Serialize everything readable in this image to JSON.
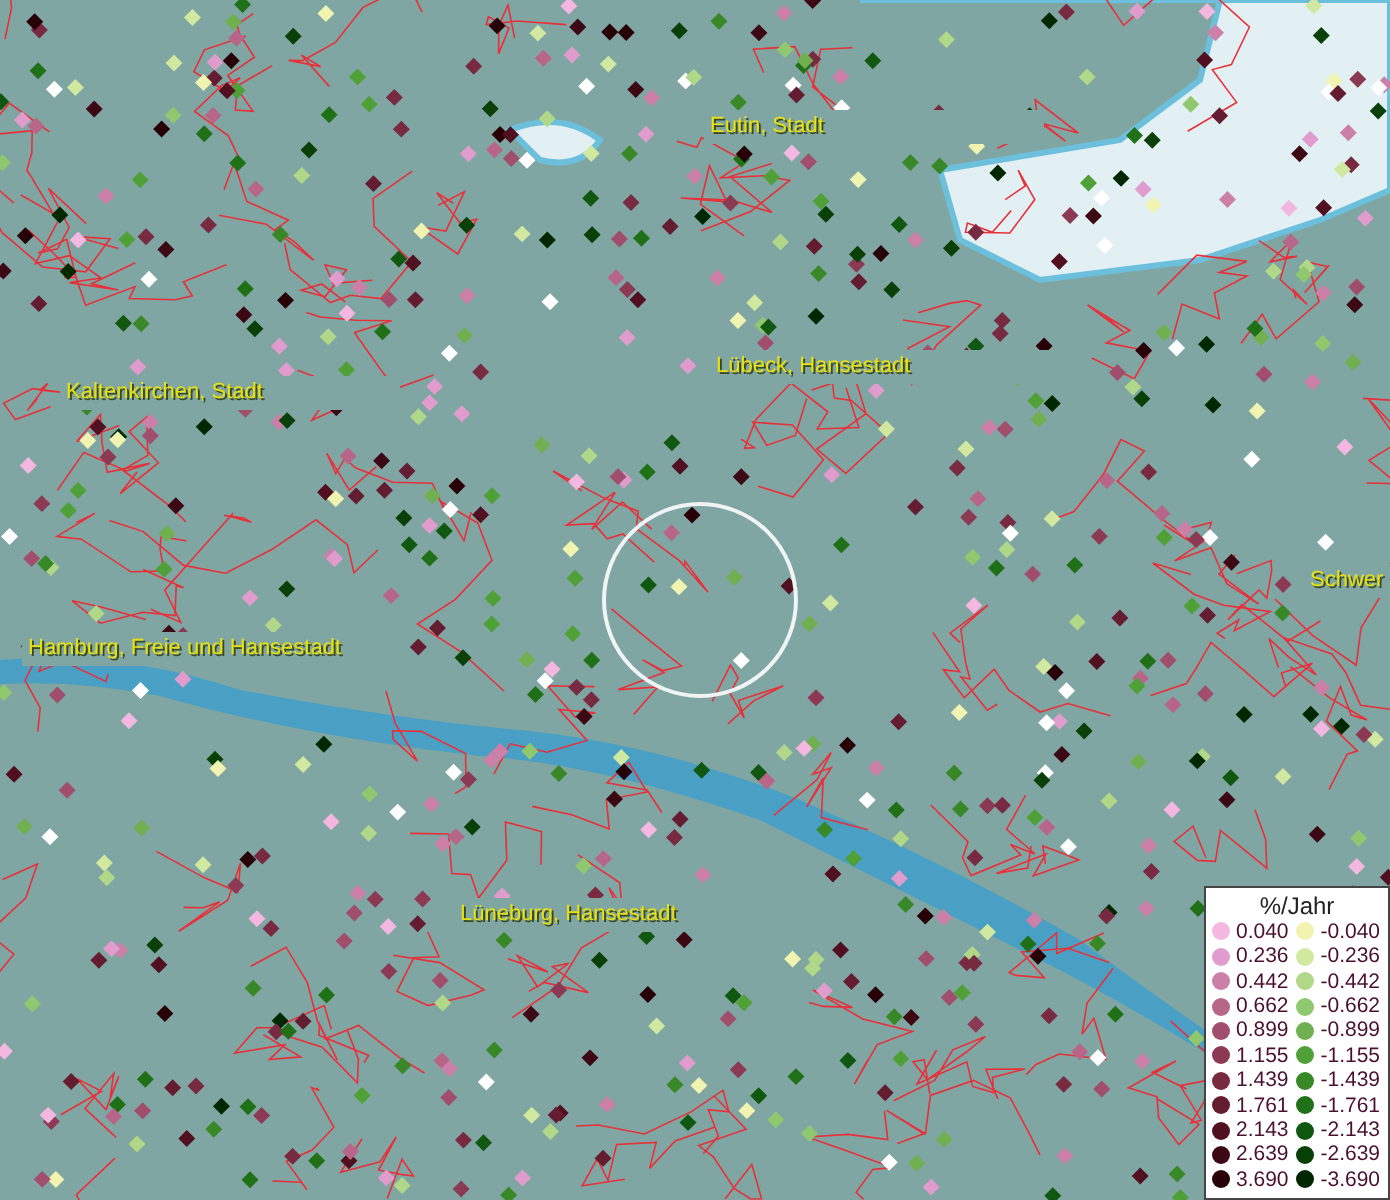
{
  "map_labels": [
    {
      "text": "Eutin, Stadt"
    },
    {
      "text": "Lübeck, Hansestadt"
    },
    {
      "text": "Kaltenkirchen, Stadt"
    },
    {
      "text": "Hamburg, Freie und Hansestadt"
    },
    {
      "text": "Lüneburg, Hansestadt"
    },
    {
      "text": "Schwer"
    }
  ],
  "legend": {
    "title": "%/Jahr",
    "entries": [
      {
        "label": "0.040",
        "color": "#f4b8e0"
      },
      {
        "label": "0.236",
        "color": "#e09ccc"
      },
      {
        "label": "0.442",
        "color": "#cc80a8"
      },
      {
        "label": "0.662",
        "color": "#b86688"
      },
      {
        "label": "0.899",
        "color": "#a04e6c"
      },
      {
        "label": "1.155",
        "color": "#8c3a54"
      },
      {
        "label": "1.439",
        "color": "#782a40"
      },
      {
        "label": "1.761",
        "color": "#641c30"
      },
      {
        "label": "2.143",
        "color": "#501020"
      },
      {
        "label": "2.639",
        "color": "#3c0814"
      },
      {
        "label": "3.690",
        "color": "#280008"
      },
      {
        "label": "-0.040",
        "color": "#f0f4b0"
      },
      {
        "label": "-0.236",
        "color": "#d0e8a0"
      },
      {
        "label": "-0.442",
        "color": "#b0d888"
      },
      {
        "label": "-0.662",
        "color": "#90c870"
      },
      {
        "label": "-0.899",
        "color": "#70b050"
      },
      {
        "label": "-1.155",
        "color": "#50a038"
      },
      {
        "label": "-1.439",
        "color": "#388828"
      },
      {
        "label": "-1.761",
        "color": "#207018"
      },
      {
        "label": "-2.143",
        "color": "#105810"
      },
      {
        "label": "-2.639",
        "color": "#084008"
      },
      {
        "label": "-3.690",
        "color": "#002800"
      }
    ]
  }
}
